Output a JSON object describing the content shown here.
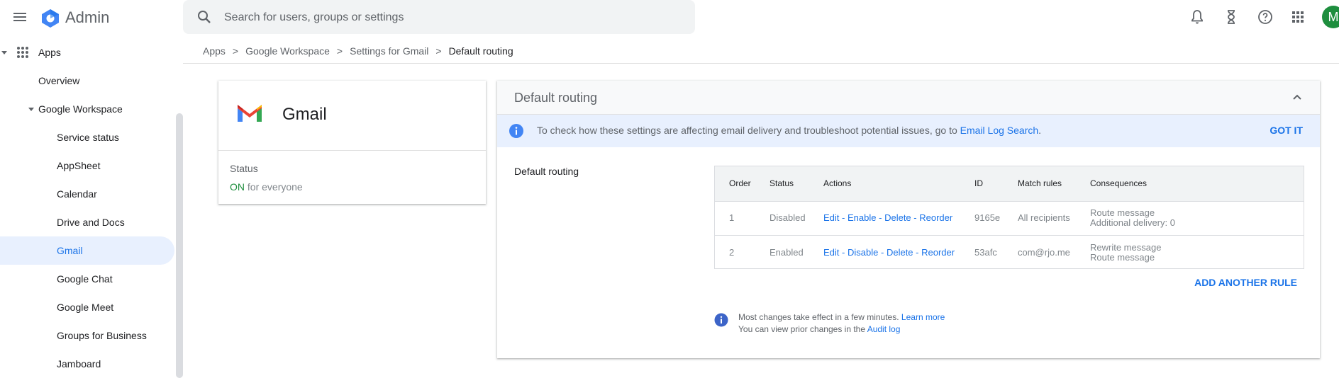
{
  "header": {
    "brand": "Admin",
    "search_placeholder": "Search for users, groups or settings",
    "avatar_initial": "M",
    "icons": [
      "menu-icon",
      "admin-logo-icon",
      "search-icon",
      "notifications-icon",
      "tasks-hourglass-icon",
      "help-icon",
      "apps-grid-icon"
    ]
  },
  "nav": {
    "apps": "Apps",
    "overview": "Overview",
    "workspace": "Google Workspace",
    "items": [
      {
        "label": "Service status"
      },
      {
        "label": "AppSheet"
      },
      {
        "label": "Calendar"
      },
      {
        "label": "Drive and Docs"
      },
      {
        "label": "Gmail"
      },
      {
        "label": "Google Chat"
      },
      {
        "label": "Google Meet"
      },
      {
        "label": "Groups for Business"
      },
      {
        "label": "Jamboard"
      }
    ],
    "active": "Gmail"
  },
  "breadcrumb": {
    "items": [
      "Apps",
      "Google Workspace",
      "Settings for Gmail"
    ],
    "separator": ">",
    "current": "Default routing"
  },
  "app_card": {
    "name": "Gmail",
    "status_label": "Status",
    "status_on": "ON",
    "status_rest": "for everyone"
  },
  "panel": {
    "title": "Default routing",
    "banner": {
      "text": "To check how these settings are affecting email delivery and troubleshoot potential issues, go to",
      "link": "Email Log Search",
      "end": ".",
      "dismiss": "GOT IT"
    },
    "section_label": "Default routing",
    "table": {
      "headers": [
        "Order",
        "Status",
        "Actions",
        "ID",
        "Match rules",
        "Consequences"
      ],
      "rows": [
        {
          "order": "1",
          "status": "Disabled",
          "actions": [
            "Edit",
            "Enable",
            "Delete",
            "Reorder"
          ],
          "id": "9165e",
          "match": "All recipients",
          "consequences": [
            "Route message",
            "Additional delivery: 0"
          ]
        },
        {
          "order": "2",
          "status": "Enabled",
          "actions": [
            "Edit",
            "Disable",
            "Delete",
            "Reorder"
          ],
          "id": "53afc",
          "match": "com@rjo.me",
          "consequences": [
            "Rewrite message",
            "Route message"
          ]
        }
      ]
    },
    "add_rule": "ADD ANOTHER RULE",
    "note": {
      "line1": "Most changes take effect in a few minutes.",
      "link1": "Learn more",
      "line2": "You can view prior changes in the",
      "link2": "Audit log"
    }
  },
  "colors": {
    "accent": "#1a73e8",
    "on_status": "#1e8e3e",
    "avatar": "#1e8e3e",
    "active_nav_bg": "#e8f0fe",
    "banner_bg": "#e8f0fe"
  }
}
